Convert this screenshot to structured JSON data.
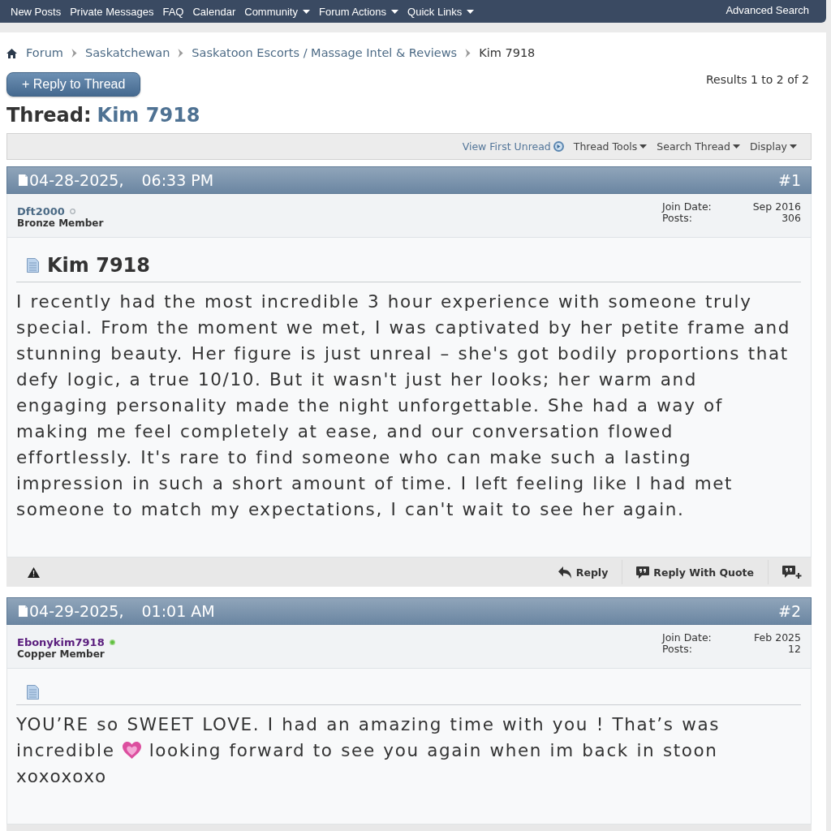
{
  "navbar": {
    "links": [
      {
        "label": "New Posts",
        "dropdown": false
      },
      {
        "label": "Private Messages",
        "dropdown": false
      },
      {
        "label": "FAQ",
        "dropdown": false
      },
      {
        "label": "Calendar",
        "dropdown": false
      },
      {
        "label": "Community",
        "dropdown": true
      },
      {
        "label": "Forum Actions",
        "dropdown": true
      },
      {
        "label": "Quick Links",
        "dropdown": true
      }
    ],
    "right_link": "Advanced Search"
  },
  "breadcrumb": [
    {
      "label": "Forum",
      "current": false
    },
    {
      "label": "Saskatchewan",
      "current": false
    },
    {
      "label": "Saskatoon Escorts / Massage Intel & Reviews",
      "current": false
    },
    {
      "label": "Kim 7918",
      "current": true
    }
  ],
  "reply_button": "+ Reply to Thread",
  "results": "Results 1 to 2 of 2",
  "thread_title": {
    "prefix": "Thread:",
    "title": "Kim 7918"
  },
  "toolbar": [
    {
      "kind": "link",
      "label": "View First Unread"
    },
    {
      "kind": "menu",
      "label": "Thread Tools"
    },
    {
      "kind": "menu",
      "label": "Search Thread"
    },
    {
      "kind": "menu",
      "label": "Display"
    }
  ],
  "posts": [
    {
      "date": "04-28-2025,",
      "time": "06:33 PM",
      "number": "#1",
      "user": {
        "name": "Dft2000",
        "color": "#4b6a85",
        "online": false,
        "rank": "Bronze Member"
      },
      "stats": [
        {
          "label": "Join Date:",
          "value": "Sep 2016"
        },
        {
          "label": "Posts:",
          "value": "306"
        }
      ],
      "title": "Kim 7918",
      "message": [
        {
          "kind": "text",
          "text": "I recently had the most incredible 3 hour experience with someone truly special. From the moment we met, I was captivated by her petite frame and stunning beauty. Her figure is just unreal – she's got bodily proportions that defy logic, a true 10/10. But it wasn't just her looks; her warm and engaging personality made the night unforgettable. She had a way of making me feel completely at ease, and our conversation flowed effortlessly. It's rare to find someone who can make such a lasting impression in such a short amount of time. I left feeling like I had met someone to match my expectations, I can't wait to see her again."
        }
      ],
      "actions": [
        {
          "kind": "report"
        },
        {
          "kind": "reply",
          "label": "Reply"
        },
        {
          "kind": "quote",
          "label": "Reply With Quote"
        },
        {
          "kind": "multiquote"
        }
      ]
    },
    {
      "date": "04-29-2025,",
      "time": "01:01 AM",
      "number": "#2",
      "user": {
        "name": "Ebonykim7918",
        "color": "#5a1d7d",
        "online": true,
        "rank": "Copper Member"
      },
      "stats": [
        {
          "label": "Join Date:",
          "value": "Feb 2025"
        },
        {
          "label": "Posts:",
          "value": "12"
        }
      ],
      "message": [
        {
          "kind": "text",
          "text": "YOU’RE so SWEET LOVE. I had an amazing time with you ! That’s was incredible"
        },
        {
          "kind": "emoji"
        },
        {
          "kind": "text",
          "text": "looking forward to see you again when im back in stoon xoxoxoxo"
        }
      ]
    }
  ]
}
